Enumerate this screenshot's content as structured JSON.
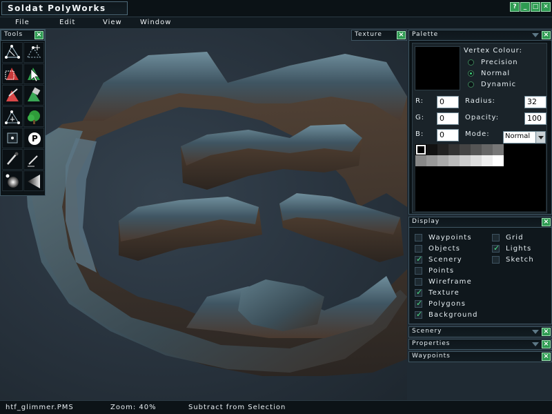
{
  "app": {
    "title": "Soldat PolyWorks",
    "window_buttons": [
      "?",
      "_",
      "□",
      "✕"
    ]
  },
  "menu": [
    "File",
    "Edit",
    "View",
    "Window"
  ],
  "tools": {
    "title": "Tools",
    "items": [
      "vertex-select-icon",
      "vertex-add-icon",
      "polygon-select-icon",
      "polygon-move-icon",
      "poly-color-icon",
      "vertex-color-icon",
      "poly-create-icon",
      "scenery-tree-icon",
      "spawn-icon",
      "waypoint-p-icon",
      "color-picker-icon",
      "pencil-icon",
      "light-icon",
      "gradient-icon"
    ]
  },
  "texture_tab": {
    "label": "Texture"
  },
  "palette": {
    "title": "Palette",
    "vertex_colour_label": "Vertex Colour:",
    "modes": [
      "Precision",
      "Normal",
      "Dynamic"
    ],
    "selected_mode_index": 1,
    "r_label": "R:",
    "r_value": "0",
    "g_label": "G:",
    "g_value": "0",
    "b_label": "B:",
    "b_value": "0",
    "radius_label": "Radius:",
    "radius_value": "32",
    "opacity_label": "Opacity:",
    "opacity_value": "100",
    "mode_label": "Mode:",
    "mode_value": "Normal",
    "swatch_colors": [
      "#000000",
      "#111111",
      "#222222",
      "#333333",
      "#444444",
      "#555555",
      "#666666",
      "#777777",
      "#888888",
      "#999999",
      "#aaaaaa",
      "#bbbbbb",
      "#cccccc",
      "#dddddd",
      "#eeeeee",
      "#ffffff"
    ]
  },
  "display": {
    "title": "Display",
    "left": [
      {
        "label": "Waypoints",
        "checked": false
      },
      {
        "label": "Objects",
        "checked": false
      },
      {
        "label": "Scenery",
        "checked": true
      },
      {
        "label": "Points",
        "checked": false
      },
      {
        "label": "Wireframe",
        "checked": false
      },
      {
        "label": "Texture",
        "checked": true
      },
      {
        "label": "Polygons",
        "checked": true
      },
      {
        "label": "Background",
        "checked": true
      }
    ],
    "right": [
      {
        "label": "Grid",
        "checked": false
      },
      {
        "label": "Lights",
        "checked": true
      },
      {
        "label": "Sketch",
        "checked": false
      }
    ]
  },
  "collapsed_panels": [
    "Scenery",
    "Properties",
    "Waypoints"
  ],
  "status": {
    "file": "htf_glimmer.PMS",
    "zoom": "Zoom: 40%",
    "mode": "Subtract from Selection"
  }
}
